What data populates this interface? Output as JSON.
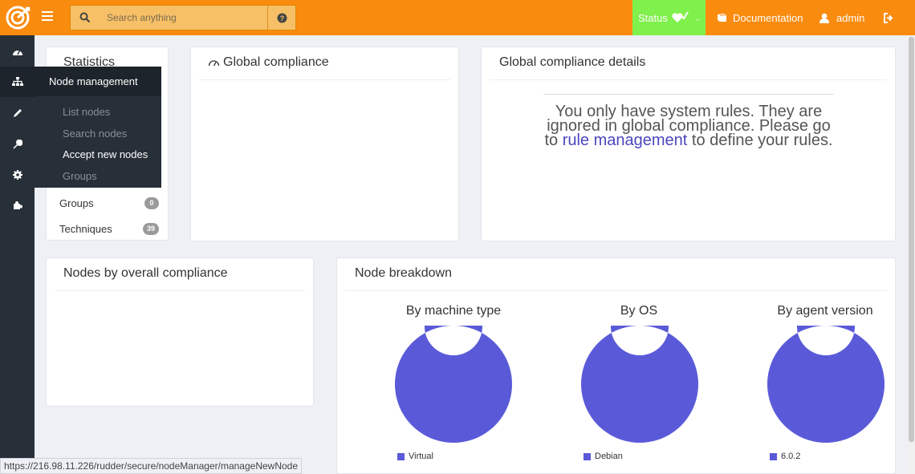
{
  "header": {
    "search_placeholder": "Search anything",
    "status_label": "Status",
    "documentation_label": "Documentation",
    "user_label": "admin"
  },
  "sidebar": {
    "icons": [
      "dashboard-icon",
      "sitemap-icon",
      "pencil-icon",
      "wrench-icon",
      "settings-gear-icon",
      "plugin-puzzle-icon"
    ]
  },
  "submenu": {
    "title": "Node management",
    "items": [
      {
        "label": "List nodes"
      },
      {
        "label": "Search nodes"
      },
      {
        "label": "Accept new nodes"
      },
      {
        "label": "Groups"
      }
    ]
  },
  "statistics": {
    "title": "Statistics",
    "rows": [
      {
        "label": "Groups",
        "count": "0"
      },
      {
        "label": "Techniques",
        "count": "39"
      }
    ]
  },
  "global_compliance": {
    "title": "Global compliance"
  },
  "compliance_details": {
    "title": "Global compliance details",
    "message_before": "You only have system rules. They are ignored in global compliance. Please go to ",
    "message_link": "rule management",
    "message_after": " to define your rules."
  },
  "nodes_by_compliance": {
    "title": "Nodes by overall compliance"
  },
  "node_breakdown": {
    "title": "Node breakdown",
    "charts": [
      {
        "title": "By machine type",
        "legend": "Virtual"
      },
      {
        "title": "By OS",
        "legend": "Debian"
      },
      {
        "title": "By agent version",
        "legend": "6.0.2"
      }
    ]
  },
  "chart_data": [
    {
      "type": "pie",
      "title": "By machine type",
      "categories": [
        "Virtual"
      ],
      "values": [
        100
      ]
    },
    {
      "type": "pie",
      "title": "By OS",
      "categories": [
        "Debian"
      ],
      "values": [
        100
      ]
    },
    {
      "type": "pie",
      "title": "By agent version",
      "categories": [
        "6.0.2"
      ],
      "values": [
        100
      ]
    }
  ],
  "statusbar": {
    "url": "https://216.98.11.226/rudder/secure/nodeManager/manageNewNode"
  },
  "colors": {
    "topbar": "#f98b0f",
    "status_ok": "#80f04c",
    "sidebar": "#272f38",
    "donut": "#5a5ad9",
    "link": "#4a46bd"
  }
}
